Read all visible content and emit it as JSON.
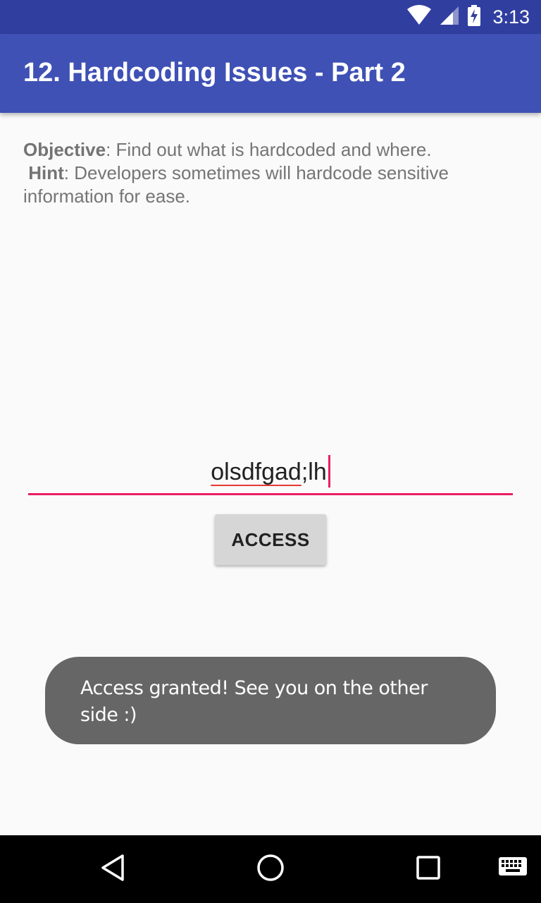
{
  "status_bar": {
    "time": "3:13",
    "icons": [
      "wifi-icon",
      "signal-icon",
      "battery-charging-icon"
    ]
  },
  "app_bar": {
    "title": "12. Hardcoding Issues - Part 2"
  },
  "description": {
    "objective_label": "Objective",
    "objective_text": ": Find out what is hardcoded and where.",
    "hint_label": "Hint",
    "hint_text": ": Developers sometimes will hardcode sensitive information for ease."
  },
  "input": {
    "value_underlined": "olsdfgad",
    "value_rest": ";lh"
  },
  "access_button": {
    "label": "ACCESS"
  },
  "toast": {
    "message": "Access granted! See you on the other side :)"
  },
  "nav_bar": {
    "icons": [
      "back-icon",
      "home-icon",
      "recents-icon",
      "keyboard-icon"
    ]
  },
  "colors": {
    "status_bar": "#303f9f",
    "app_bar": "#3f51b5",
    "accent": "#e91e63",
    "toast": "#666666"
  }
}
